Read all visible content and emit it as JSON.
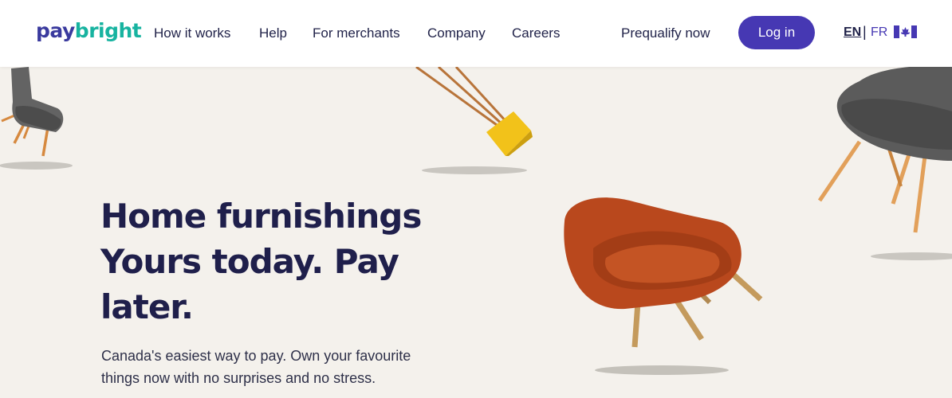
{
  "brand": {
    "logo_pay": "pay",
    "logo_bright": "bright",
    "pay_color": "#3a3a9e",
    "bright_color": "#17b3a0"
  },
  "nav": {
    "items": [
      "How it works",
      "Help",
      "For merchants",
      "Company",
      "Careers"
    ],
    "prequalify": "Prequalify now",
    "login": "Log in",
    "lang_en": "EN",
    "lang_sep": "|",
    "lang_fr": "FR"
  },
  "hero": {
    "title": "Home furnishings Yours today. Pay later.",
    "subtitle": "Canada's easiest way to pay. Own your favourite things now with no surprises and no stress."
  },
  "colors": {
    "accent": "#4638b3",
    "background": "#f4f1ec",
    "heading": "#1f1f4b",
    "chair_orange": "#b9481d",
    "chair_gray": "#5a5a5a",
    "lamp_yellow": "#f2c21a"
  }
}
